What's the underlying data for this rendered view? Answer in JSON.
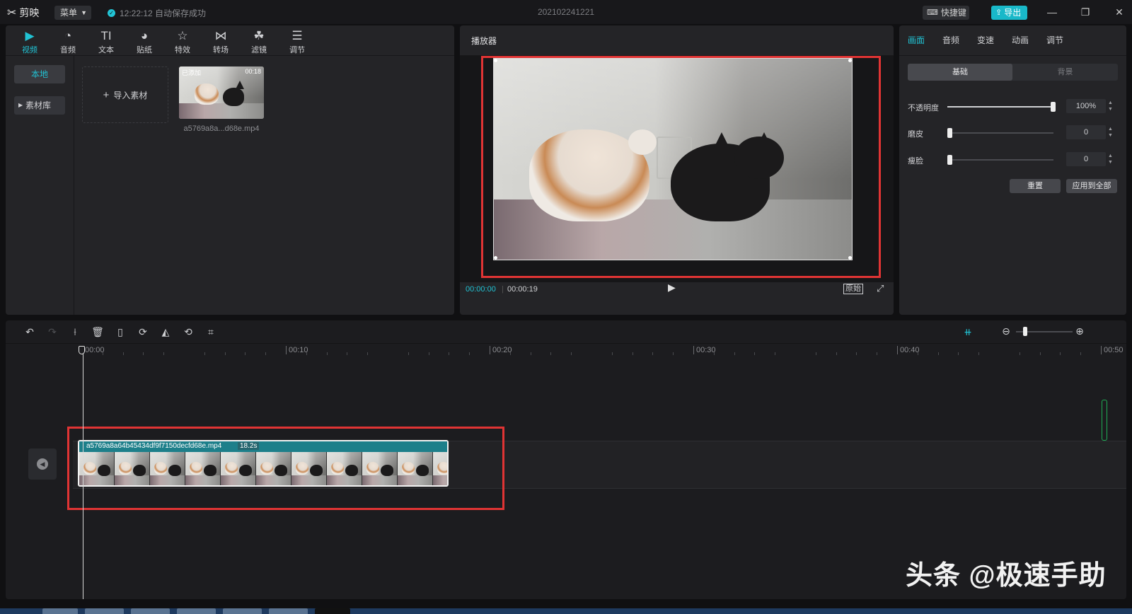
{
  "app": {
    "name": "剪映",
    "menu_label": "菜单",
    "save_status": "12:22:12 自动保存成功",
    "project_title": "202102241221",
    "shortcut_label": "快捷键",
    "export_label": "导出"
  },
  "media_tools": [
    {
      "label": "视频",
      "icon": "video-icon"
    },
    {
      "label": "音频",
      "icon": "audio-icon"
    },
    {
      "label": "文本",
      "icon": "text-icon"
    },
    {
      "label": "贴纸",
      "icon": "sticker-icon"
    },
    {
      "label": "特效",
      "icon": "effects-icon"
    },
    {
      "label": "转场",
      "icon": "transition-icon"
    },
    {
      "label": "滤镜",
      "icon": "filter-icon"
    },
    {
      "label": "调节",
      "icon": "adjust-icon"
    }
  ],
  "media_side": {
    "local": "本地",
    "library": "素材库"
  },
  "media": {
    "import_label": "导入素材",
    "thumb_tag": "已添加",
    "thumb_duration": "00:18",
    "file_name": "a5769a8a...d68e.mp4"
  },
  "player": {
    "title": "播放器",
    "current_time": "00:00:00",
    "total_time": "00:00:19",
    "original_label": "原始"
  },
  "props": {
    "tabs": [
      "画面",
      "音频",
      "变速",
      "动画",
      "调节"
    ],
    "subtabs": {
      "basic": "基础",
      "background": "背景"
    },
    "rows": [
      {
        "label": "不透明度",
        "value": "100%",
        "level": 1.0
      },
      {
        "label": "磨皮",
        "value": "0",
        "level": 0.0
      },
      {
        "label": "瘦脸",
        "value": "0",
        "level": 0.0
      }
    ],
    "reset_label": "重置",
    "apply_all_label": "应用到全部"
  },
  "timeline": {
    "ticks": [
      "00:00",
      "00:10",
      "00:20",
      "00:30",
      "00:40",
      "00:50"
    ],
    "clip_name": "a5769a8a64b45434df9f7150decfd68e.mp4",
    "clip_duration": "18.2s"
  },
  "watermark": "头条 @极速手助",
  "colors": {
    "accent": "#21c2d3",
    "highlight": "#e03434",
    "panel": "#242427"
  }
}
